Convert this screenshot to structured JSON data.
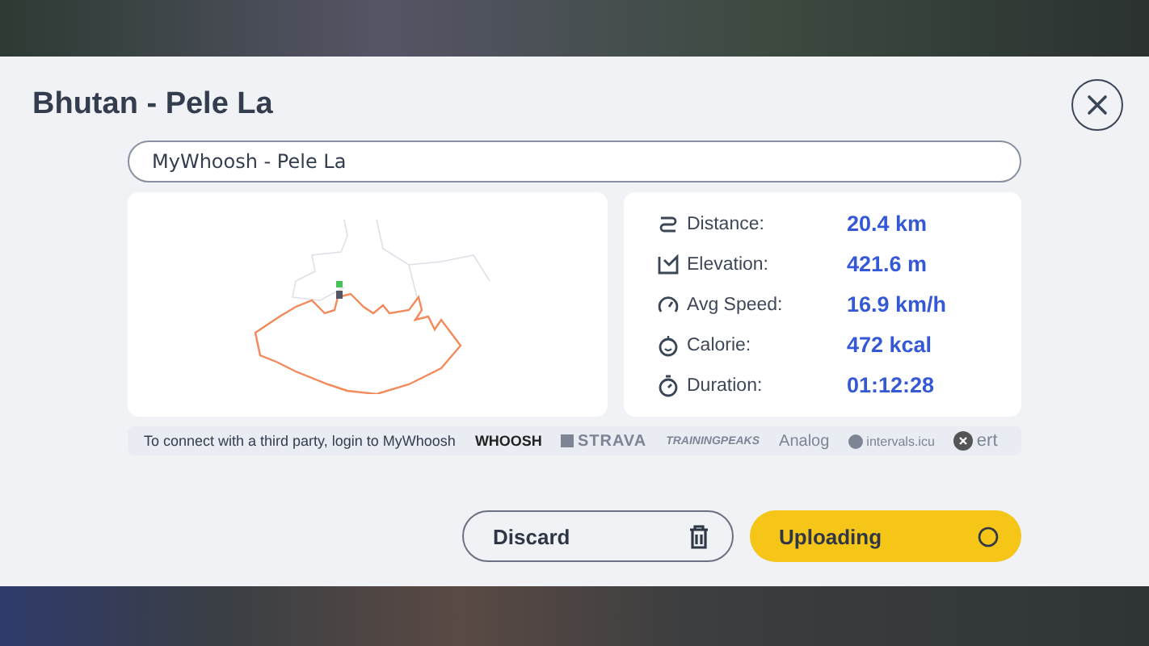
{
  "dialog": {
    "title": "Bhutan - Pele La"
  },
  "name_field": {
    "value": "MyWhoosh - Pele La"
  },
  "stats": [
    {
      "kind": "distance",
      "label": "Distance:",
      "value": "20.4 km"
    },
    {
      "kind": "elevation",
      "label": "Elevation:",
      "value": "421.6 m"
    },
    {
      "kind": "speed",
      "label": "Avg Speed:",
      "value": "16.9 km/h"
    },
    {
      "kind": "calorie",
      "label": "Calorie:",
      "value": "472 kcal"
    },
    {
      "kind": "duration",
      "label": "Duration:",
      "value": "01:12:28"
    }
  ],
  "connect": {
    "text": "To connect with a third party, login to MyWhoosh",
    "partners": [
      {
        "kind": "whoosh",
        "label": "WHOOSH"
      },
      {
        "kind": "strava",
        "label": "STRAVA"
      },
      {
        "kind": "trainingpeaks",
        "label": "TRAININGPEAKS"
      },
      {
        "kind": "analog",
        "label": "Analog"
      },
      {
        "kind": "intervals",
        "label": "intervals.icu"
      },
      {
        "kind": "xert",
        "label": "ert"
      }
    ]
  },
  "buttons": [
    {
      "kind": "discard",
      "label": "Discard"
    },
    {
      "kind": "uploading",
      "label": "Uploading"
    }
  ]
}
